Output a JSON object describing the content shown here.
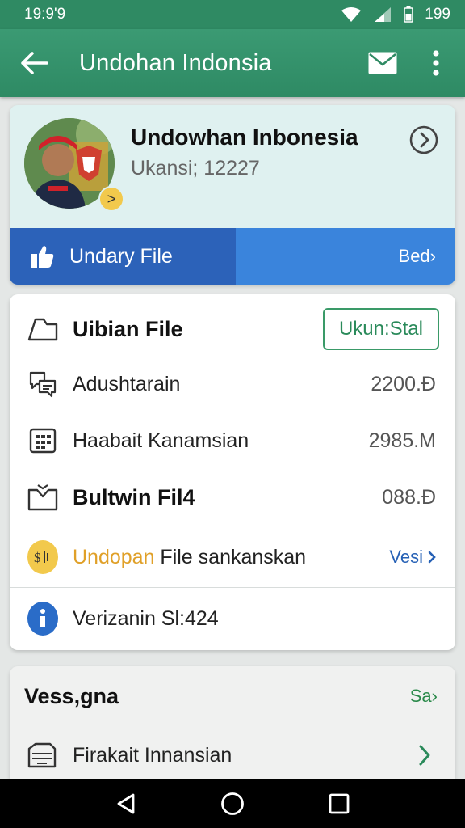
{
  "status_bar": {
    "time": "19:9'9",
    "battery": "199",
    "icons": [
      "wifi-icon",
      "signal-icon",
      "battery-icon"
    ]
  },
  "app_bar": {
    "title": "Undohan Indonsia",
    "icons": [
      "back-arrow-icon",
      "mail-icon",
      "more-vert-icon"
    ]
  },
  "profile": {
    "name": "Undowhan Inbonesia",
    "subtitle": "Ukansi; 12227",
    "badge_glyph": ">",
    "upload_label": "Undary File",
    "upload_action": "Bed›"
  },
  "files": {
    "header_label": "Uibian File",
    "header_button": "Ukun:Stal",
    "rows": [
      {
        "label": "Adushtarain",
        "value": "2200.Đ",
        "icon": "chat-icon"
      },
      {
        "label": "Haabait Kanamsian",
        "value": "2985.M",
        "icon": "calendar-icon"
      },
      {
        "label": "Bultwin Fil4",
        "value": "088.Đ",
        "icon": "inbox-icon"
      }
    ],
    "update_row": {
      "label_highlight": "Undopan",
      "label_rest": " File sankanskan",
      "link": "Vesi",
      "icon": "info-badge-icon"
    },
    "version_row": {
      "label": "Verizanin Sl:424",
      "icon": "info-icon"
    }
  },
  "settings": {
    "title": "Vess,gna",
    "link": "Sa›",
    "row_label": "Firakait Innansian",
    "row_icon": "folder-icon"
  },
  "colors": {
    "primary": "#2f8a63",
    "upload_dark": "#2c62b9",
    "upload_light": "#3a84dc",
    "accent_blue": "#2560b5",
    "accent_orange": "#e0a028",
    "accent_green": "#2a8a5a"
  }
}
